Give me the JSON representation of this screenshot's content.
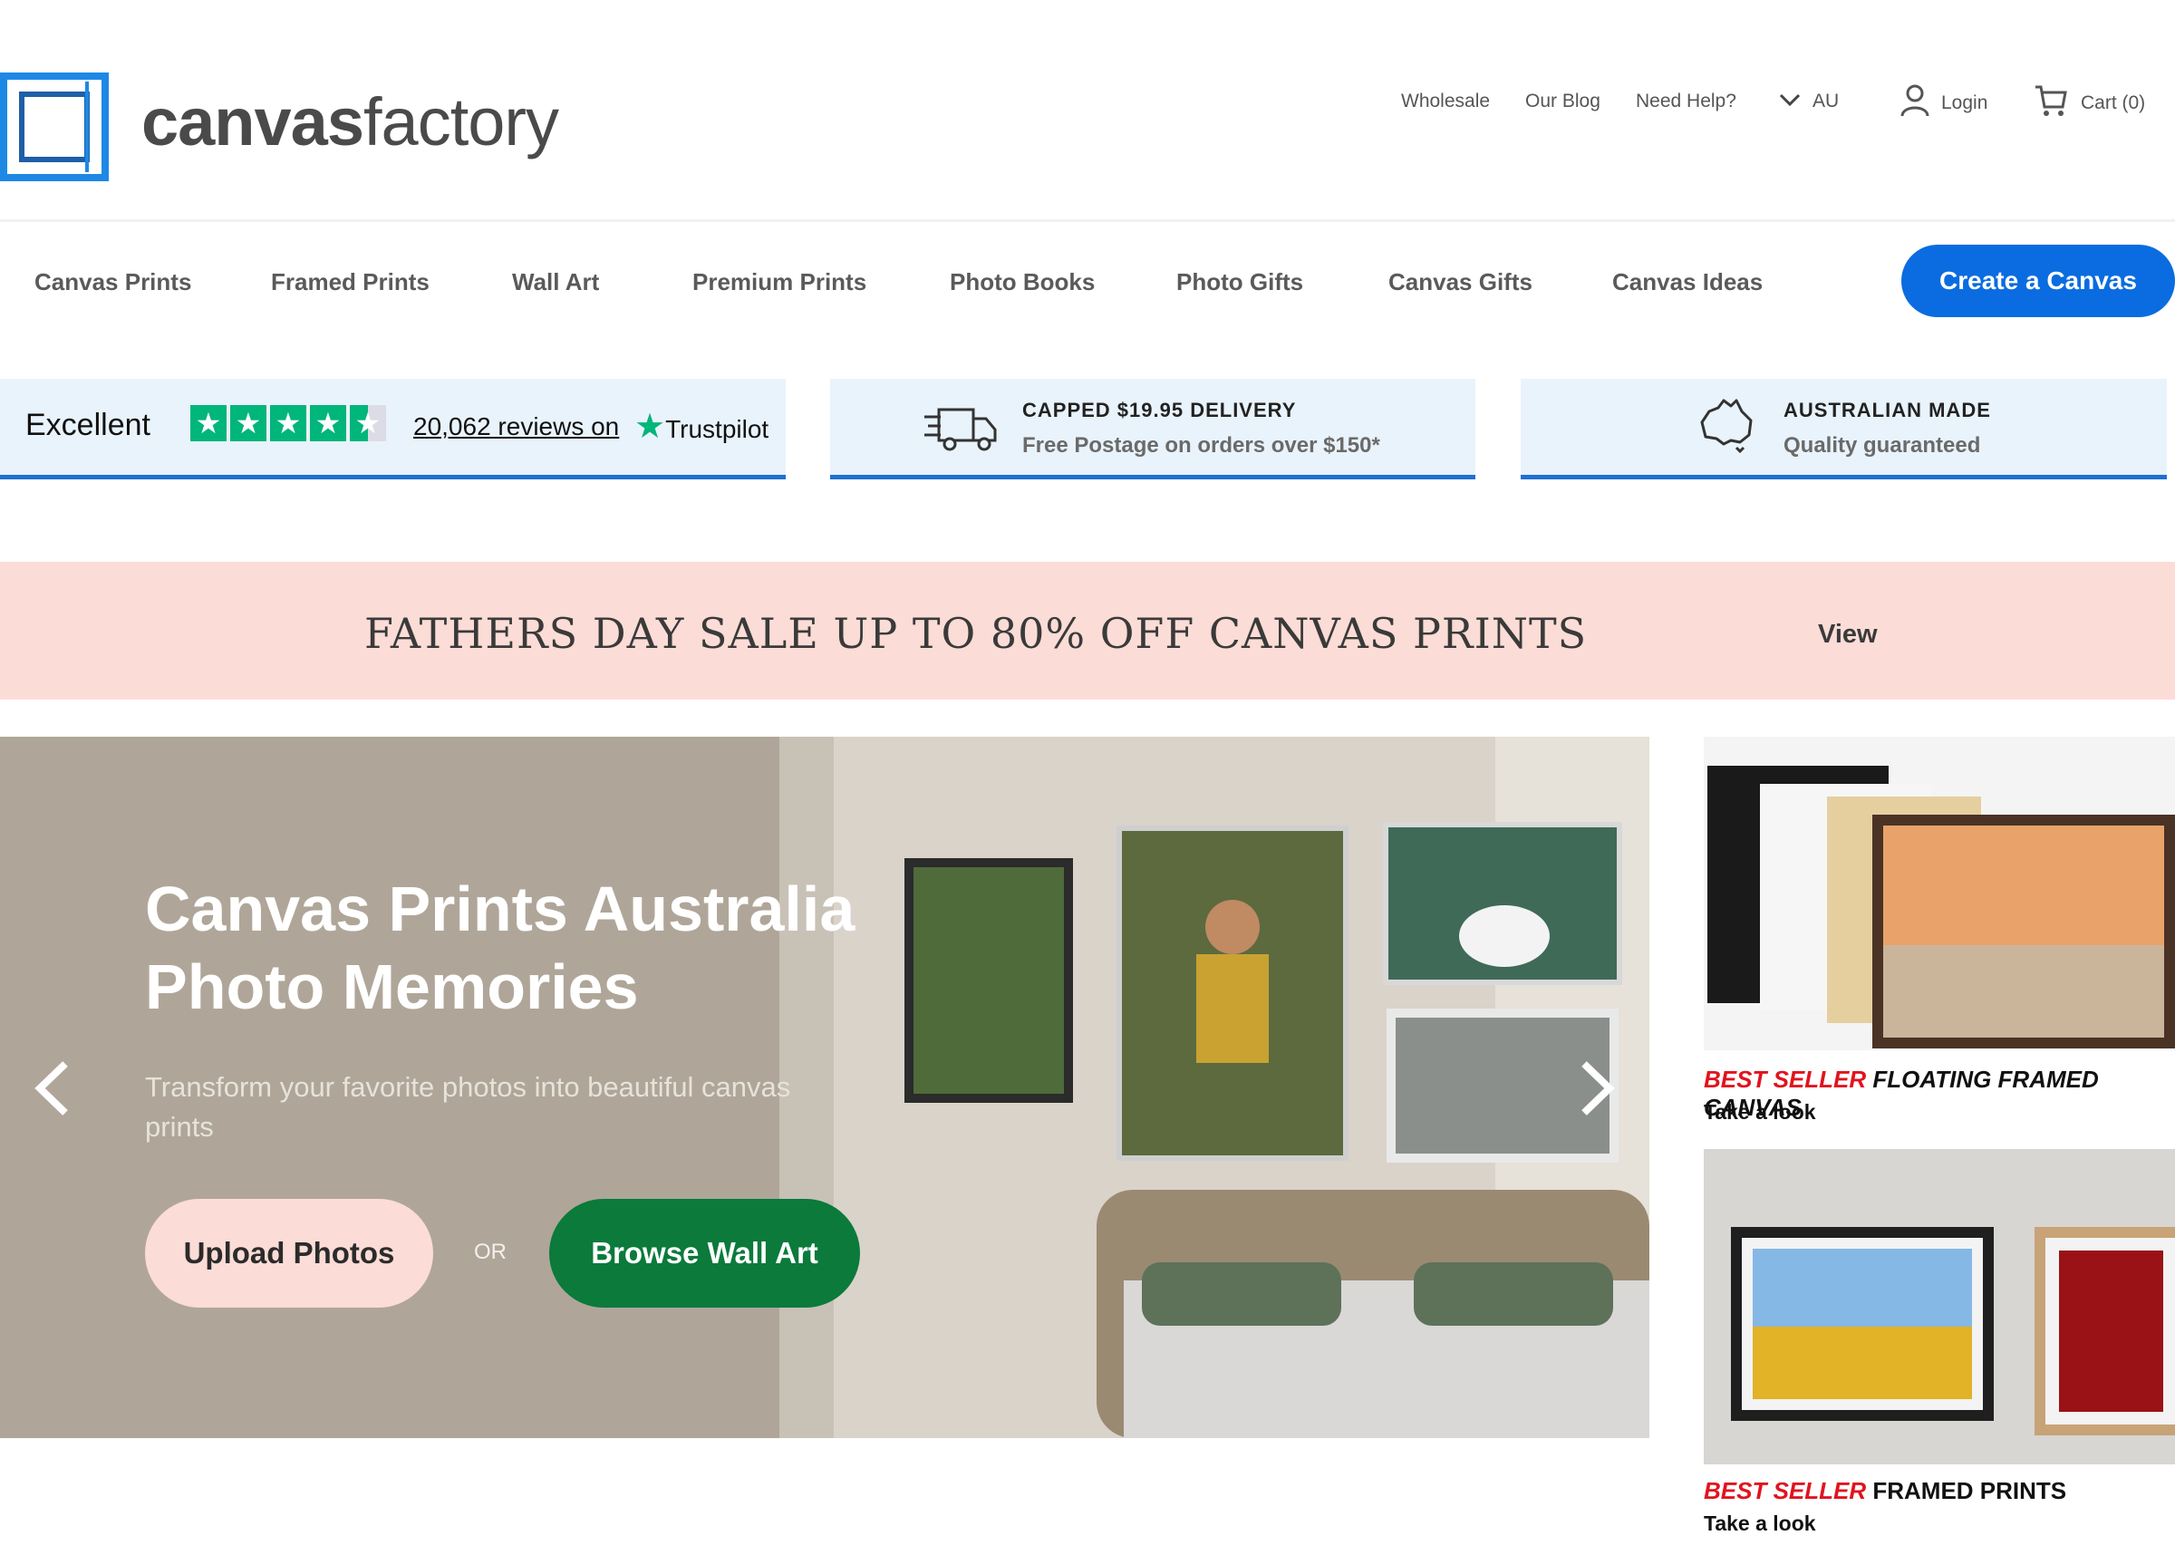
{
  "header": {
    "logo_bold": "canvas",
    "logo_light": "factory",
    "links": {
      "wholesale": "Wholesale",
      "blog": "Our Blog",
      "help": "Need Help?",
      "region": "AU",
      "login": "Login",
      "cart": "Cart (0)"
    },
    "icons": [
      "chevron-down-icon",
      "user-icon",
      "cart-icon"
    ]
  },
  "nav": {
    "items": [
      "Canvas Prints",
      "Framed Prints",
      "Wall Art",
      "Premium Prints",
      "Photo Books",
      "Photo Gifts",
      "Canvas Gifts",
      "Canvas Ideas"
    ],
    "cta": "Create a Canvas"
  },
  "info": {
    "trustpilot": {
      "rating_label": "Excellent",
      "stars": 4.5,
      "reviews": "20,062 reviews on",
      "brand": "Trustpilot"
    },
    "delivery": {
      "title": "CAPPED $19.95 DELIVERY",
      "subtitle": "Free Postage on orders over $150*"
    },
    "made": {
      "title": "AUSTRALIAN MADE",
      "subtitle": "Quality guaranteed"
    }
  },
  "promo": {
    "text": "FATHERS DAY SALE UP TO 80% OFF CANVAS PRINTS",
    "link": "View"
  },
  "hero": {
    "title_line1": "Canvas Prints Australia",
    "title_line2": "Photo Memories",
    "subtitle": "Transform your favorite photos into beautiful canvas prints",
    "upload": "Upload Photos",
    "or": "OR",
    "browse": "Browse Wall Art"
  },
  "cards": [
    {
      "badge": "BEST SELLER",
      "title": "FLOATING FRAMED CANVAS",
      "link": "Take a look"
    },
    {
      "badge": "BEST SELLER",
      "title": "FRAMED PRINTS",
      "link": "Take a look"
    }
  ],
  "colors": {
    "brand_blue": "#0a6ce0",
    "green": "#0b7a3b",
    "promo_pink": "#fcdcd6",
    "trustpilot_green": "#00b67a",
    "best_seller_red": "#e0141e"
  }
}
